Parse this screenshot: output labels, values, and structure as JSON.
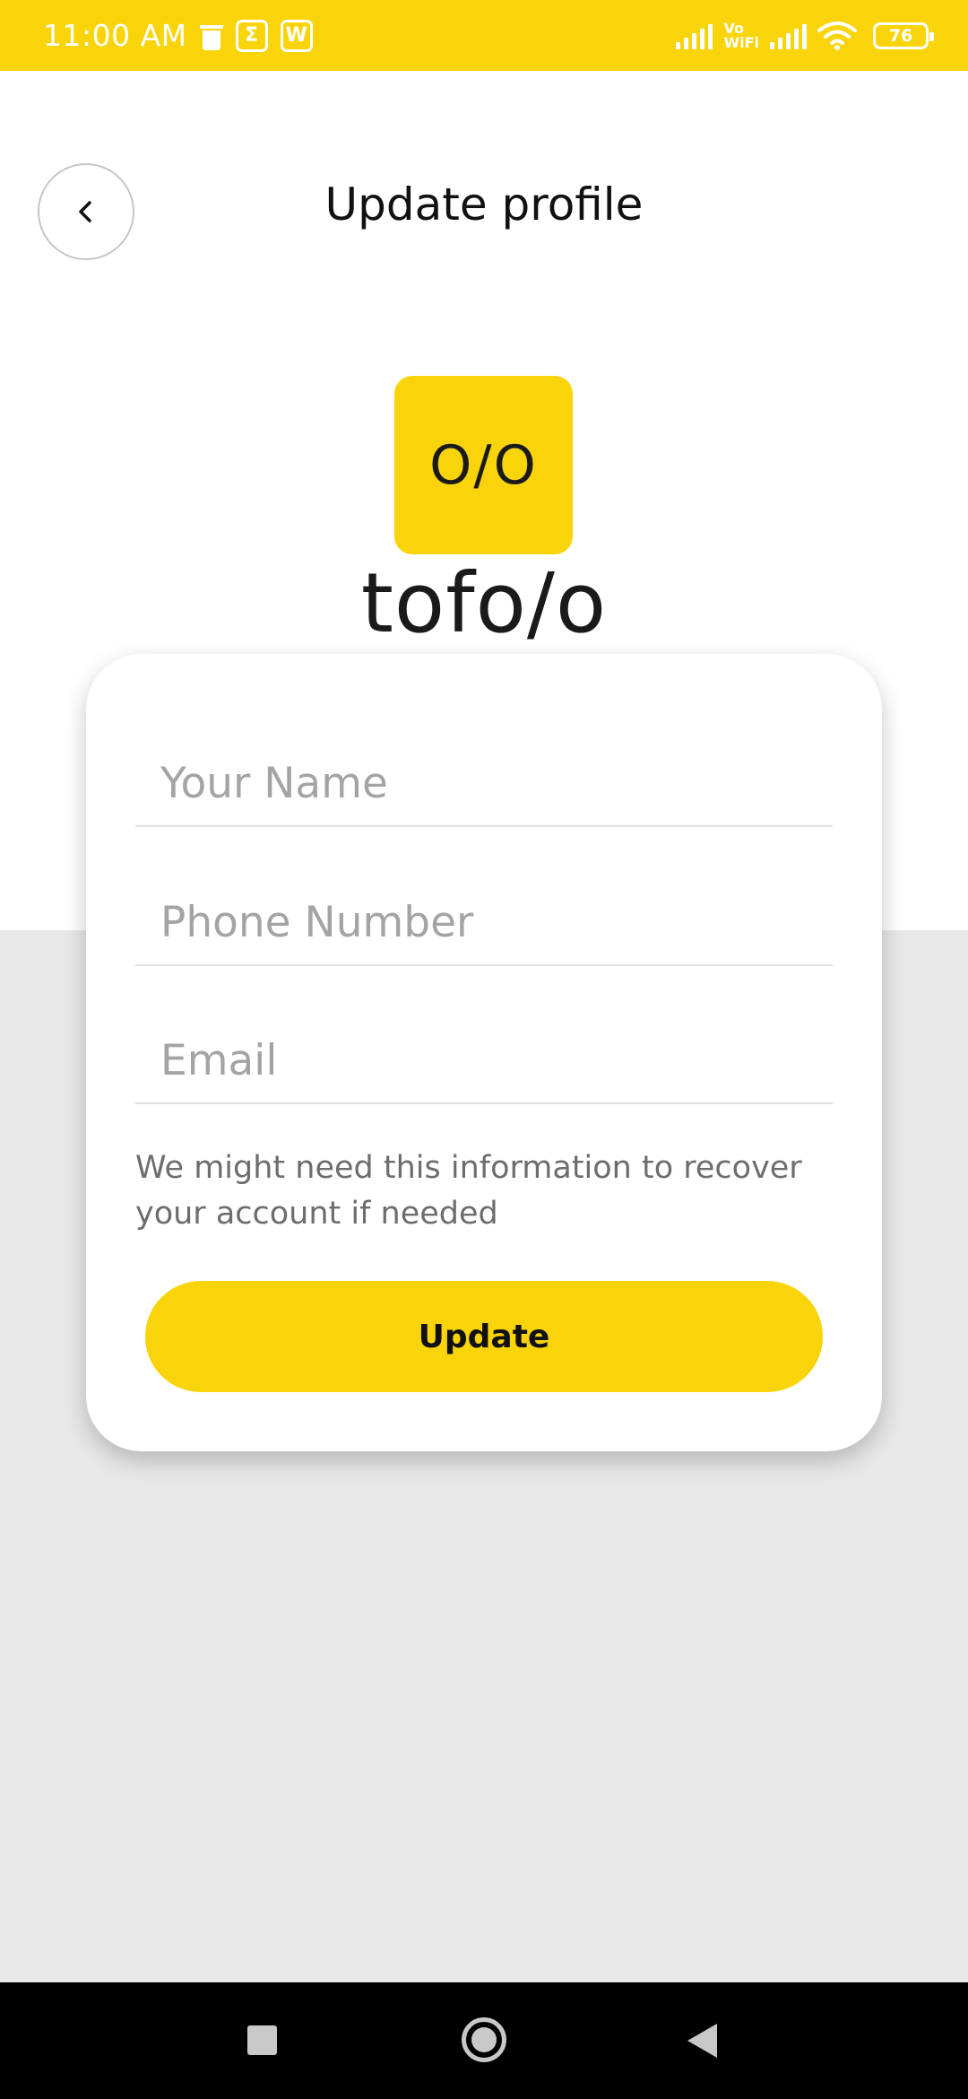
{
  "status_bar": {
    "time": "11:00 AM",
    "vo_wifi_line1": "Vo",
    "vo_wifi_line2": "WiFi",
    "battery": "76",
    "icons": [
      "trash-icon",
      "sigma-app-icon",
      "w-app-icon",
      "signal-icon",
      "vowifi-icon",
      "signal-icon",
      "wifi-icon",
      "battery-icon"
    ]
  },
  "header": {
    "title": "Update profile",
    "back_icon": "chevron-left-icon"
  },
  "brand": {
    "logo_mark": "O/O",
    "name": "tofo/o",
    "color": "#fad40a"
  },
  "form": {
    "name_placeholder": "Your Name",
    "phone_placeholder": "Phone Number",
    "email_placeholder": "Email",
    "helper_text": "We might need this information to recover your account if needed",
    "submit_label": "Update"
  },
  "nav_bar": {
    "icons": [
      "recent-apps-icon",
      "home-icon",
      "back-icon"
    ]
  }
}
